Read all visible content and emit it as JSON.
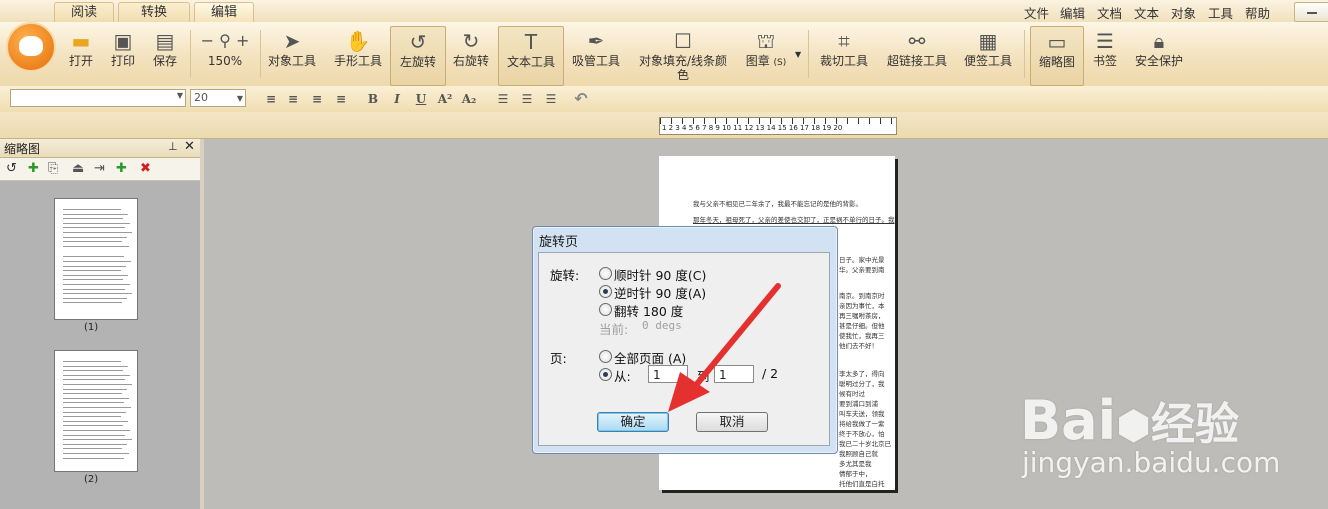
{
  "tabs": [
    "阅读",
    "转换",
    "编辑"
  ],
  "menu": [
    "文件",
    "编辑",
    "文档",
    "文本",
    "对象",
    "工具",
    "帮助"
  ],
  "toolbar": {
    "open": "打开",
    "print": "打印",
    "save": "保存",
    "zoom": "150%",
    "object_tool": "对象工具",
    "hand_tool": "手形工具",
    "rotate_left": "左旋转",
    "rotate_right": "右旋转",
    "text_tool": "文本工具",
    "eyedropper": "吸管工具",
    "fill_line_color_1": "对象填充/线条颜",
    "fill_line_color_2": "色",
    "stamp": "图章",
    "stamp_shortcut": "(S)",
    "crop": "裁切工具",
    "hyperlink": "超链接工具",
    "note": "便签工具",
    "thumbnail": "缩略图",
    "bookmark": "书签",
    "security": "安全保护"
  },
  "format_bar": {
    "font_size": "20",
    "bold": "B",
    "italic": "I",
    "underline": "U",
    "superscript": "A²",
    "subscript": "A₂"
  },
  "ruler_label": "1 2 3 4 5 6 7 8 9 10 11 12 13 14 15 16 17 18 19 20",
  "panel": {
    "title": "缩略图",
    "thumbs": [
      "(1)",
      "(2)"
    ]
  },
  "page_text": [
    "我与父亲不相见已二年余了，我最不能忘记的是他的背影。",
    "那年冬天，祖母死了，父亲的差使也交卸了，正是祸不单行的日子。我",
    "日子。家中光景",
    "华。父亲要到南",
    "南京。到南京时",
    "亲因为事忙，本",
    "再三嘱咐茶房，",
    "甚是仔细。但他",
    "使我忙，我再三",
    "他们去不好！",
    "要到浦口到浦",
    "叫车夫送，领我",
    "将给我做了一紫",
    "终于不放心，怕",
    "我已二十岁北京已",
    "我照顾自己就",
    "多尤其是我",
    "情郁于中，",
    "他之种种不",
    "李太多了，得向",
    "聪明过分了，我",
    "候有时过",
    "托他们直是白托"
  ],
  "dialog": {
    "title": "旋转页",
    "rotation_label": "旋转:",
    "cw": "顺时针 90 度(C)",
    "ccw": "逆时针 90 度(A)",
    "flip": "翻转 180 度",
    "current_label": "当前:",
    "current_value": "0 degs",
    "pages_label": "页:",
    "all_pages": "全部页面 (A)",
    "from_label": "从:",
    "from_value": "1",
    "to_label": "到",
    "to_value": "1",
    "total": "/  2",
    "ok": "确定",
    "cancel": "取消"
  },
  "watermark": {
    "brand": "Bai",
    "brand2": "经验",
    "url": "jingyan.baidu.com"
  },
  "colors": {
    "ribbon": "#f3e2be",
    "dialog_frame": "#d3e2f2",
    "arrow": "#e53030"
  }
}
